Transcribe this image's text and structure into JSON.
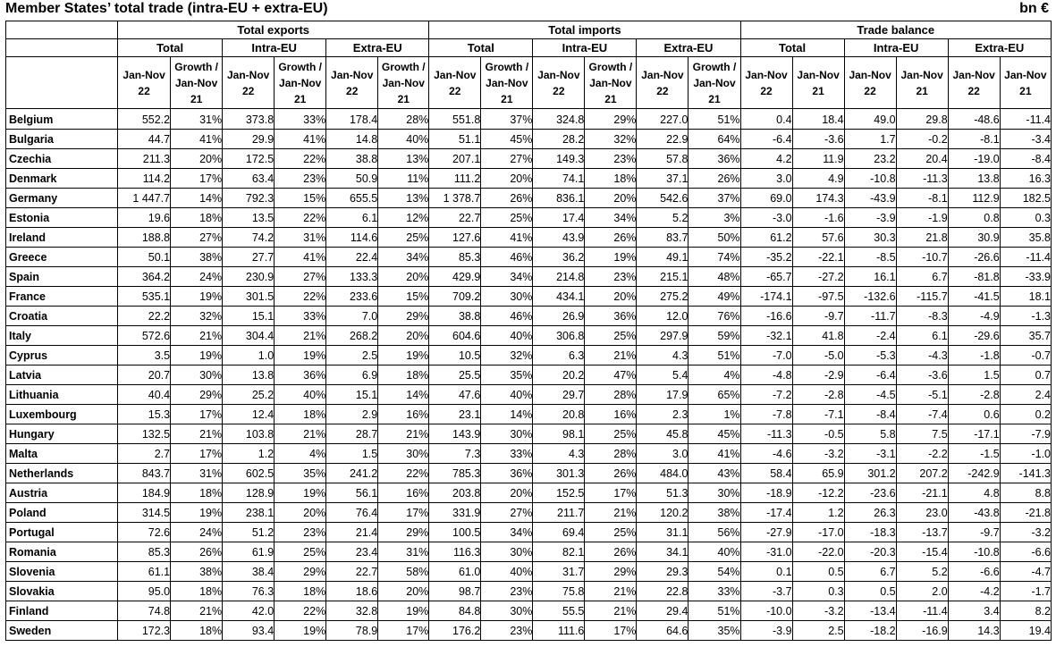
{
  "title": "Member States’ total trade (intra-EU + extra-EU)",
  "unit": "bn €",
  "groups": [
    "Total exports",
    "Total imports",
    "Trade balance"
  ],
  "subgroups": [
    "Total",
    "Intra-EU",
    "Extra-EU",
    "Total",
    "Intra-EU",
    "Extra-EU",
    "Total",
    "Intra-EU",
    "Extra-EU"
  ],
  "period_headers": [
    "Jan-Nov 22",
    "Growth / Jan-Nov 21",
    "Jan-Nov 22",
    "Growth / Jan-Nov 21",
    "Jan-Nov 22",
    "Growth / Jan-Nov 21",
    "Jan-Nov 22",
    "Growth / Jan-Nov 21",
    "Jan-Nov 22",
    "Growth / Jan-Nov 21",
    "Jan-Nov 22",
    "Growth / Jan-Nov 21",
    "Jan-Nov 22",
    "Jan-Nov 21",
    "Jan-Nov 22",
    "Jan-Nov 21",
    "Jan-Nov 22",
    "Jan-Nov 21"
  ],
  "rows": [
    {
      "country": "Belgium",
      "values": [
        "552.2",
        "31%",
        "373.8",
        "33%",
        "178.4",
        "28%",
        "551.8",
        "37%",
        "324.8",
        "29%",
        "227.0",
        "51%",
        "0.4",
        "18.4",
        "49.0",
        "29.8",
        "-48.6",
        "-11.4"
      ]
    },
    {
      "country": "Bulgaria",
      "values": [
        "44.7",
        "41%",
        "29.9",
        "41%",
        "14.8",
        "40%",
        "51.1",
        "45%",
        "28.2",
        "32%",
        "22.9",
        "64%",
        "-6.4",
        "-3.6",
        "1.7",
        "-0.2",
        "-8.1",
        "-3.4"
      ]
    },
    {
      "country": "Czechia",
      "values": [
        "211.3",
        "20%",
        "172.5",
        "22%",
        "38.8",
        "13%",
        "207.1",
        "27%",
        "149.3",
        "23%",
        "57.8",
        "36%",
        "4.2",
        "11.9",
        "23.2",
        "20.4",
        "-19.0",
        "-8.4"
      ]
    },
    {
      "country": "Denmark",
      "values": [
        "114.2",
        "17%",
        "63.4",
        "23%",
        "50.9",
        "11%",
        "111.2",
        "20%",
        "74.1",
        "18%",
        "37.1",
        "26%",
        "3.0",
        "4.9",
        "-10.8",
        "-11.3",
        "13.8",
        "16.3"
      ]
    },
    {
      "country": "Germany",
      "values": [
        "1 447.7",
        "14%",
        "792.3",
        "15%",
        "655.5",
        "13%",
        "1 378.7",
        "26%",
        "836.1",
        "20%",
        "542.6",
        "37%",
        "69.0",
        "174.3",
        "-43.9",
        "-8.1",
        "112.9",
        "182.5"
      ]
    },
    {
      "country": "Estonia",
      "values": [
        "19.6",
        "18%",
        "13.5",
        "22%",
        "6.1",
        "12%",
        "22.7",
        "25%",
        "17.4",
        "34%",
        "5.2",
        "3%",
        "-3.0",
        "-1.6",
        "-3.9",
        "-1.9",
        "0.8",
        "0.3"
      ]
    },
    {
      "country": "Ireland",
      "values": [
        "188.8",
        "27%",
        "74.2",
        "31%",
        "114.6",
        "25%",
        "127.6",
        "41%",
        "43.9",
        "26%",
        "83.7",
        "50%",
        "61.2",
        "57.6",
        "30.3",
        "21.8",
        "30.9",
        "35.8"
      ]
    },
    {
      "country": "Greece",
      "values": [
        "50.1",
        "38%",
        "27.7",
        "41%",
        "22.4",
        "34%",
        "85.3",
        "46%",
        "36.2",
        "19%",
        "49.1",
        "74%",
        "-35.2",
        "-22.1",
        "-8.5",
        "-10.7",
        "-26.6",
        "-11.4"
      ]
    },
    {
      "country": "Spain",
      "values": [
        "364.2",
        "24%",
        "230.9",
        "27%",
        "133.3",
        "20%",
        "429.9",
        "34%",
        "214.8",
        "23%",
        "215.1",
        "48%",
        "-65.7",
        "-27.2",
        "16.1",
        "6.7",
        "-81.8",
        "-33.9"
      ]
    },
    {
      "country": "France",
      "values": [
        "535.1",
        "19%",
        "301.5",
        "22%",
        "233.6",
        "15%",
        "709.2",
        "30%",
        "434.1",
        "20%",
        "275.2",
        "49%",
        "-174.1",
        "-97.5",
        "-132.6",
        "-115.7",
        "-41.5",
        "18.1"
      ]
    },
    {
      "country": "Croatia",
      "values": [
        "22.2",
        "32%",
        "15.1",
        "33%",
        "7.0",
        "29%",
        "38.8",
        "46%",
        "26.9",
        "36%",
        "12.0",
        "76%",
        "-16.6",
        "-9.7",
        "-11.7",
        "-8.3",
        "-4.9",
        "-1.3"
      ]
    },
    {
      "country": "Italy",
      "values": [
        "572.6",
        "21%",
        "304.4",
        "21%",
        "268.2",
        "20%",
        "604.6",
        "40%",
        "306.8",
        "25%",
        "297.9",
        "59%",
        "-32.1",
        "41.8",
        "-2.4",
        "6.1",
        "-29.6",
        "35.7"
      ]
    },
    {
      "country": "Cyprus",
      "values": [
        "3.5",
        "19%",
        "1.0",
        "19%",
        "2.5",
        "19%",
        "10.5",
        "32%",
        "6.3",
        "21%",
        "4.3",
        "51%",
        "-7.0",
        "-5.0",
        "-5.3",
        "-4.3",
        "-1.8",
        "-0.7"
      ]
    },
    {
      "country": "Latvia",
      "values": [
        "20.7",
        "30%",
        "13.8",
        "36%",
        "6.9",
        "18%",
        "25.5",
        "35%",
        "20.2",
        "47%",
        "5.4",
        "4%",
        "-4.8",
        "-2.9",
        "-6.4",
        "-3.6",
        "1.5",
        "0.7"
      ]
    },
    {
      "country": "Lithuania",
      "values": [
        "40.4",
        "29%",
        "25.2",
        "40%",
        "15.1",
        "14%",
        "47.6",
        "40%",
        "29.7",
        "28%",
        "17.9",
        "65%",
        "-7.2",
        "-2.8",
        "-4.5",
        "-5.1",
        "-2.8",
        "2.4"
      ]
    },
    {
      "country": "Luxembourg",
      "values": [
        "15.3",
        "17%",
        "12.4",
        "18%",
        "2.9",
        "16%",
        "23.1",
        "14%",
        "20.8",
        "16%",
        "2.3",
        "1%",
        "-7.8",
        "-7.1",
        "-8.4",
        "-7.4",
        "0.6",
        "0.2"
      ]
    },
    {
      "country": "Hungary",
      "values": [
        "132.5",
        "21%",
        "103.8",
        "21%",
        "28.7",
        "21%",
        "143.9",
        "30%",
        "98.1",
        "25%",
        "45.8",
        "45%",
        "-11.3",
        "-0.5",
        "5.8",
        "7.5",
        "-17.1",
        "-7.9"
      ]
    },
    {
      "country": "Malta",
      "values": [
        "2.7",
        "17%",
        "1.2",
        "4%",
        "1.5",
        "30%",
        "7.3",
        "33%",
        "4.3",
        "28%",
        "3.0",
        "41%",
        "-4.6",
        "-3.2",
        "-3.1",
        "-2.2",
        "-1.5",
        "-1.0"
      ]
    },
    {
      "country": "Netherlands",
      "values": [
        "843.7",
        "31%",
        "602.5",
        "35%",
        "241.2",
        "22%",
        "785.3",
        "36%",
        "301.3",
        "26%",
        "484.0",
        "43%",
        "58.4",
        "65.9",
        "301.2",
        "207.2",
        "-242.9",
        "-141.3"
      ]
    },
    {
      "country": "Austria",
      "values": [
        "184.9",
        "18%",
        "128.9",
        "19%",
        "56.1",
        "16%",
        "203.8",
        "20%",
        "152.5",
        "17%",
        "51.3",
        "30%",
        "-18.9",
        "-12.2",
        "-23.6",
        "-21.1",
        "4.8",
        "8.8"
      ]
    },
    {
      "country": "Poland",
      "values": [
        "314.5",
        "19%",
        "238.1",
        "20%",
        "76.4",
        "17%",
        "331.9",
        "27%",
        "211.7",
        "21%",
        "120.2",
        "38%",
        "-17.4",
        "1.2",
        "26.3",
        "23.0",
        "-43.8",
        "-21.8"
      ]
    },
    {
      "country": "Portugal",
      "values": [
        "72.6",
        "24%",
        "51.2",
        "23%",
        "21.4",
        "29%",
        "100.5",
        "34%",
        "69.4",
        "25%",
        "31.1",
        "56%",
        "-27.9",
        "-17.0",
        "-18.3",
        "-13.7",
        "-9.7",
        "-3.2"
      ]
    },
    {
      "country": "Romania",
      "values": [
        "85.3",
        "26%",
        "61.9",
        "25%",
        "23.4",
        "31%",
        "116.3",
        "30%",
        "82.1",
        "26%",
        "34.1",
        "40%",
        "-31.0",
        "-22.0",
        "-20.3",
        "-15.4",
        "-10.8",
        "-6.6"
      ]
    },
    {
      "country": "Slovenia",
      "values": [
        "61.1",
        "38%",
        "38.4",
        "29%",
        "22.7",
        "58%",
        "61.0",
        "40%",
        "31.7",
        "29%",
        "29.3",
        "54%",
        "0.1",
        "0.5",
        "6.7",
        "5.2",
        "-6.6",
        "-4.7"
      ]
    },
    {
      "country": "Slovakia",
      "values": [
        "95.0",
        "18%",
        "76.3",
        "18%",
        "18.6",
        "20%",
        "98.7",
        "23%",
        "75.8",
        "21%",
        "22.8",
        "33%",
        "-3.7",
        "0.3",
        "0.5",
        "2.0",
        "-4.2",
        "-1.7"
      ]
    },
    {
      "country": "Finland",
      "values": [
        "74.8",
        "21%",
        "42.0",
        "22%",
        "32.8",
        "19%",
        "84.8",
        "30%",
        "55.5",
        "21%",
        "29.4",
        "51%",
        "-10.0",
        "-3.2",
        "-13.4",
        "-11.4",
        "3.4",
        "8.2"
      ]
    },
    {
      "country": "Sweden",
      "values": [
        "172.3",
        "18%",
        "93.4",
        "19%",
        "78.9",
        "17%",
        "176.2",
        "23%",
        "111.6",
        "17%",
        "64.6",
        "35%",
        "-3.9",
        "2.5",
        "-18.2",
        "-16.9",
        "14.3",
        "19.4"
      ]
    }
  ]
}
